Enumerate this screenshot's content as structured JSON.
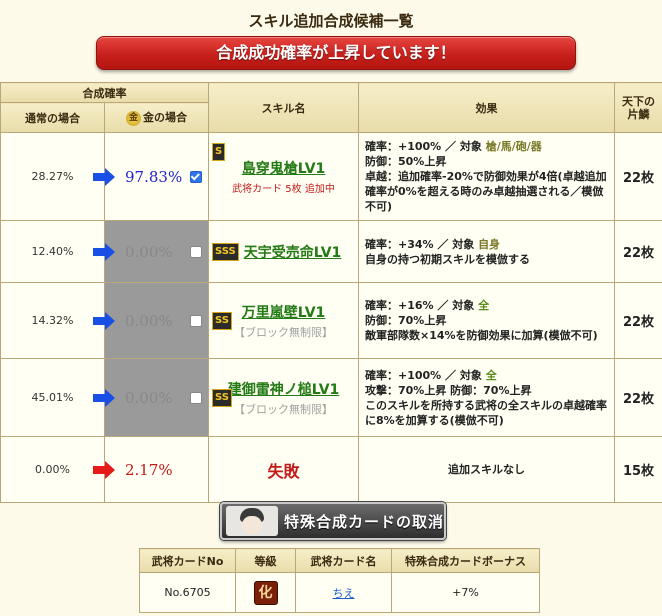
{
  "page_title": "スキル追加合成候補一覧",
  "banner": "合成成功確率が上昇しています！",
  "headers": {
    "rate_group": "合成確率",
    "normal": "通常の場合",
    "gold_icon": "金",
    "gold": "金の場合",
    "skill_name": "スキル名",
    "effect": "効果",
    "tenka_line1": "天下の",
    "tenka_line2": "片鱗"
  },
  "rows": [
    {
      "normal_rate": "28.27%",
      "gold_rate": "97.83%",
      "checked": true,
      "rank": "S",
      "skill_name": "島穿鬼槍LV1",
      "sub": "武将カード 5枚 追加中",
      "effect_line1": "確率：+100% ／ 対象",
      "effect_target": "槍/馬/砲/器",
      "effect_line2": "防御：50%上昇",
      "effect_line3": "卓越：追加確率-20%で防御効果が4倍(卓越追加確率が0%を超える時のみ卓越抽選される／模倣不可)",
      "pieces": "22枚"
    },
    {
      "normal_rate": "12.40%",
      "gold_rate": "0.00%",
      "checked": false,
      "rank": "SSS",
      "skill_name": "天宇受売命LV1",
      "sub": "",
      "effect_line1": "確率：+34% ／ 対象",
      "effect_target": "自身",
      "effect_line2": "自身の持つ初期スキルを模倣する",
      "effect_line3": "",
      "pieces": "22枚"
    },
    {
      "normal_rate": "14.32%",
      "gold_rate": "0.00%",
      "checked": false,
      "rank": "SS",
      "skill_name": "万里嵐壁LV1",
      "sub": "【ブロック無制限】",
      "effect_line1": "確率：+16% ／ 対象",
      "effect_target": "全",
      "effect_line2": "防御：70%上昇",
      "effect_line3": "敵軍部隊数×14%を防御効果に加算(模倣不可)",
      "pieces": "22枚"
    },
    {
      "normal_rate": "45.01%",
      "gold_rate": "0.00%",
      "checked": false,
      "rank": "SS",
      "skill_name": "建御雷神ノ槌LV1",
      "sub": "【ブロック無制限】",
      "effect_line1": "確率：+100% ／ 対象",
      "effect_target": "全",
      "effect_line2": "攻撃：70%上昇 防御：70%上昇",
      "effect_line3": "このスキルを所持する武将の全スキルの卓越確率に8%を加算する(模倣不可)",
      "pieces": "22枚"
    }
  ],
  "fail_row": {
    "normal_rate": "0.00%",
    "gold_rate": "2.17%",
    "label": "失敗",
    "effect": "追加スキルなし",
    "pieces": "15枚"
  },
  "cancel_button": "特殊合成カードの取消",
  "card_table": {
    "headers": [
      "武将カードNo",
      "等級",
      "武将カード名",
      "特殊合成カードボーナス"
    ],
    "row": {
      "no": "No.6705",
      "grade": "化",
      "name": "ちえ",
      "bonus": "+7%"
    }
  },
  "colors": {
    "arrow_blue": "#1a4fe6",
    "arrow_red": "#e61a1a",
    "banner_red": "#c8201c"
  }
}
